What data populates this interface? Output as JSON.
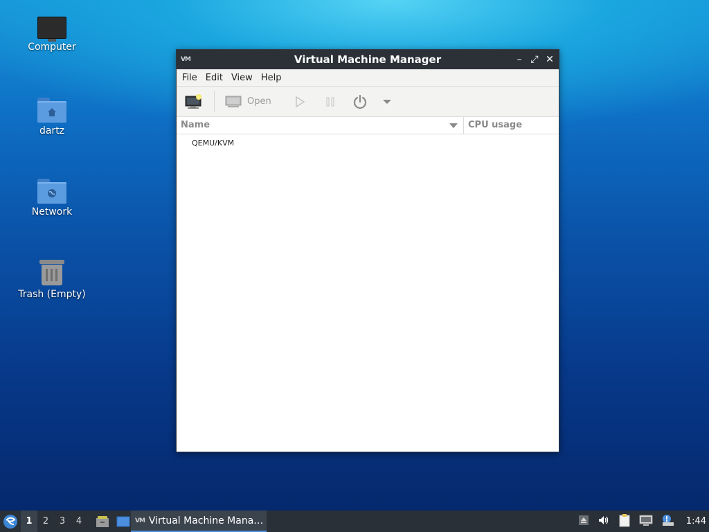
{
  "desktop": {
    "icons": [
      {
        "label": "Computer"
      },
      {
        "label": "dartz"
      },
      {
        "label": "Network"
      },
      {
        "label": "Trash (Empty)"
      }
    ]
  },
  "window": {
    "app_icon_text": "VM",
    "title": "Virtual Machine Manager",
    "menu": [
      "File",
      "Edit",
      "View",
      "Help"
    ],
    "toolbar": {
      "open_label": "Open"
    },
    "columns": {
      "name": "Name",
      "cpu": "CPU usage"
    },
    "connections": [
      {
        "name": "QEMU/KVM"
      }
    ]
  },
  "taskbar": {
    "workspaces": [
      "1",
      "2",
      "3",
      "4"
    ],
    "active_workspace": "1",
    "task_label": "Virtual Machine Mana…",
    "clock": "1:44"
  },
  "colors": {
    "titlebar": "#2b3137",
    "taskbar": "#2a3038",
    "accent": "#4c8fe0"
  }
}
